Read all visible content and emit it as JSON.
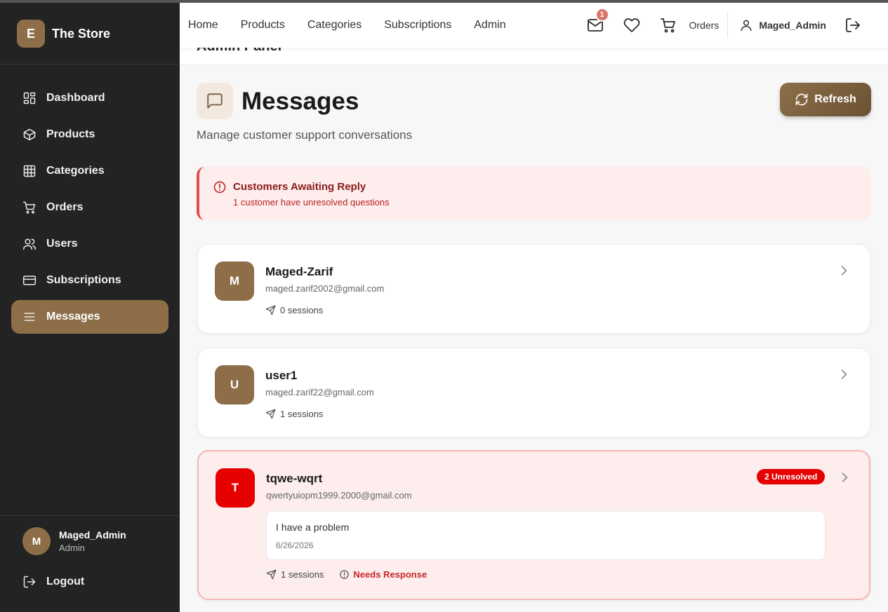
{
  "brand": {
    "logo_letter": "E",
    "name": "The Store"
  },
  "sidebar": {
    "items": [
      {
        "label": "Dashboard",
        "icon": "dashboard-icon"
      },
      {
        "label": "Products",
        "icon": "box-icon"
      },
      {
        "label": "Categories",
        "icon": "grid-icon"
      },
      {
        "label": "Orders",
        "icon": "cart-icon"
      },
      {
        "label": "Users",
        "icon": "users-icon"
      },
      {
        "label": "Subscriptions",
        "icon": "credit-card-icon"
      },
      {
        "label": "Messages",
        "icon": "menu-icon",
        "active": true
      }
    ],
    "user": {
      "avatar": "M",
      "name": "Maged_Admin",
      "role": "Admin"
    },
    "logout_label": "Logout"
  },
  "topnav": {
    "links": [
      "Home",
      "Products",
      "Categories",
      "Subscriptions",
      "Admin"
    ],
    "mail_badge": "1",
    "orders_label": "Orders",
    "username": "Maged_Admin"
  },
  "panel_strip": "Admin Panel",
  "page": {
    "title": "Messages",
    "subtitle": "Manage customer support conversations",
    "refresh_label": "Refresh"
  },
  "alert": {
    "title": "Customers Awaiting Reply",
    "description": "1 customer have unresolved questions"
  },
  "conversations": [
    {
      "avatar": "M",
      "name": "Maged-Zarif",
      "email": "maged.zarif2002@gmail.com",
      "sessions": "0 sessions"
    },
    {
      "avatar": "U",
      "name": "user1",
      "email": "maged.zarif22@gmail.com",
      "sessions": "1 sessions"
    },
    {
      "avatar": "T",
      "name": "tqwe-wqrt",
      "email": "qwertyuiopm1999.2000@gmail.com",
      "sessions": "1 sessions",
      "unresolved": "2 Unresolved",
      "last_message": "I have a problem",
      "last_date": "6/26/2026",
      "status": "Needs Response"
    }
  ],
  "colors": {
    "accent": "#8d6e49",
    "sidebar_bg": "#232323",
    "alert_red": "#e60000"
  }
}
